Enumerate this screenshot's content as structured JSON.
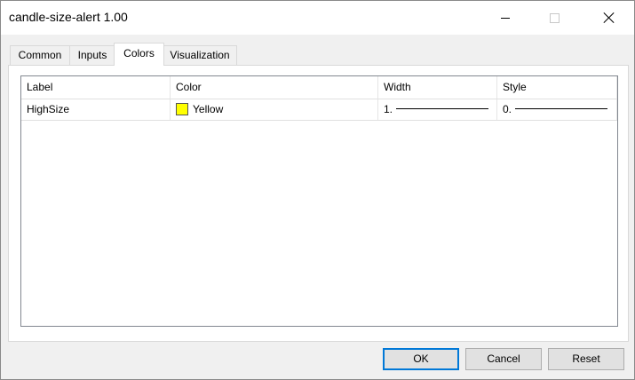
{
  "window": {
    "title": "candle-size-alert 1.00"
  },
  "tabs": [
    {
      "label": "Common",
      "active": false
    },
    {
      "label": "Inputs",
      "active": false
    },
    {
      "label": "Colors",
      "active": true
    },
    {
      "label": "Visualization",
      "active": false
    }
  ],
  "colors_table": {
    "columns": [
      "Label",
      "Color",
      "Width",
      "Style"
    ],
    "rows": [
      {
        "label": "HighSize",
        "color_name": "Yellow",
        "color_hex": "#ffff00",
        "width": "1.",
        "style": "0."
      }
    ]
  },
  "buttons": {
    "ok": "OK",
    "cancel": "Cancel",
    "reset": "Reset"
  },
  "icons": {
    "minimize": "minimize-icon",
    "maximize": "maximize-icon",
    "close": "close-icon"
  }
}
